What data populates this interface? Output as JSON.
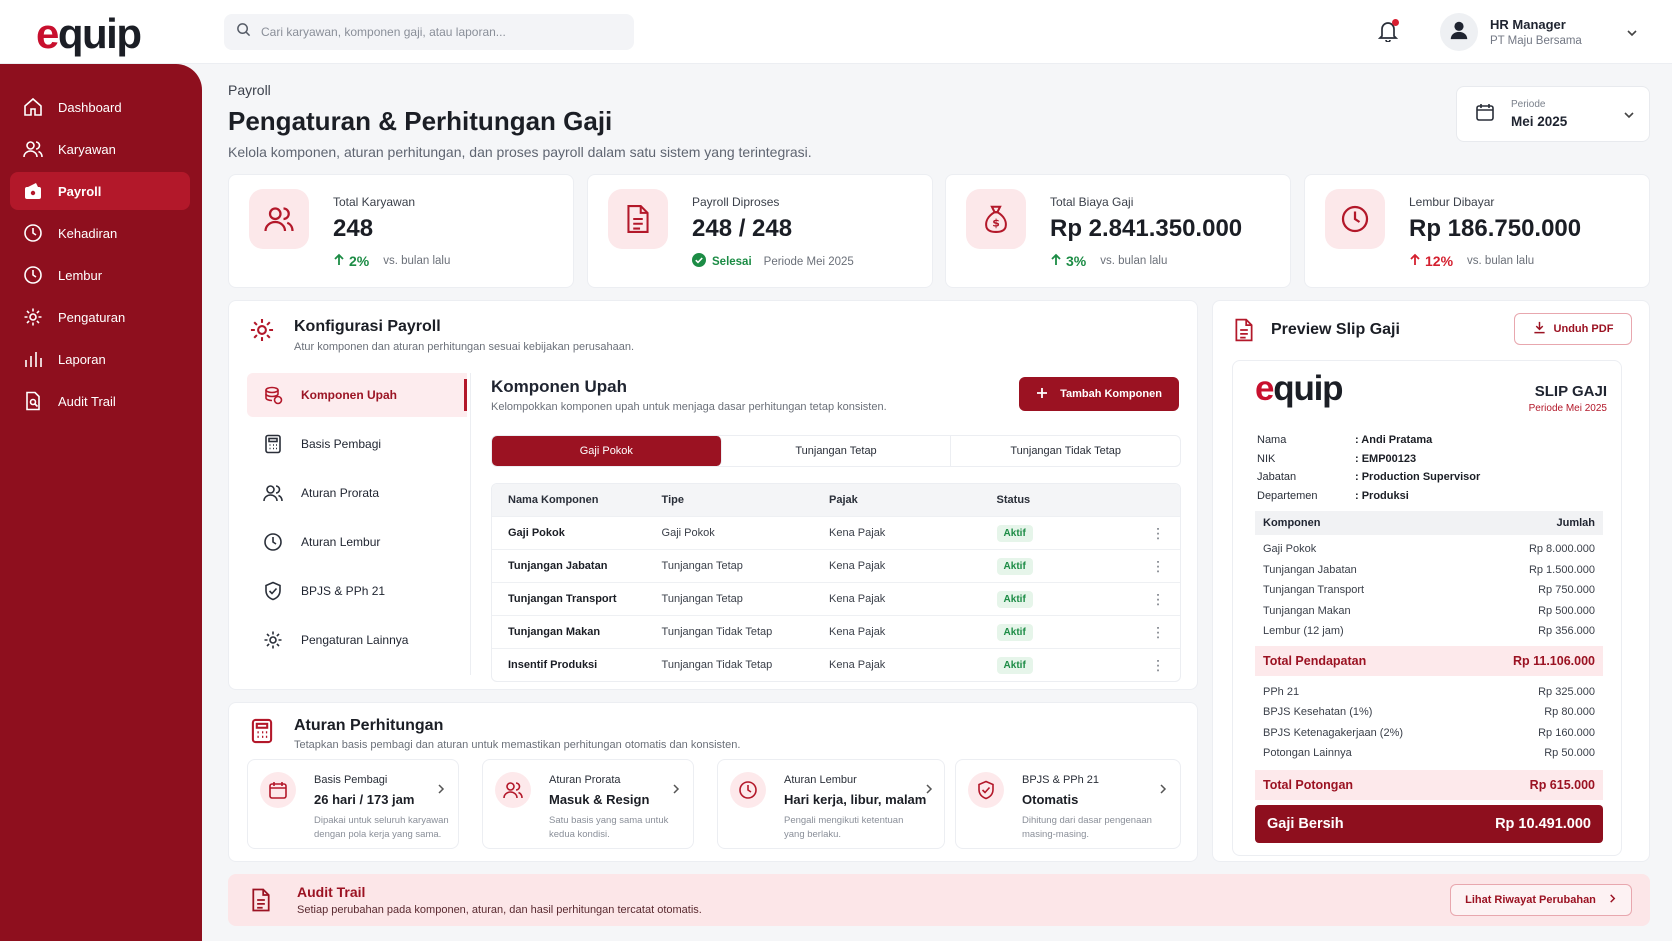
{
  "app": {
    "logo_e": "e",
    "logo_rest": "quip",
    "search_placeholder": "Cari karyawan, komponen gaji, atau laporan...",
    "user_name": "HR Manager",
    "user_company": "PT Maju Bersama"
  },
  "sidebar": {
    "items": [
      {
        "label": "Dashboard",
        "icon": "home-icon"
      },
      {
        "label": "Karyawan",
        "icon": "users-icon"
      },
      {
        "label": "Payroll",
        "icon": "wallet-icon",
        "active": true
      },
      {
        "label": "Kehadiran",
        "icon": "clock-icon"
      },
      {
        "label": "Lembur",
        "icon": "clock-icon"
      },
      {
        "label": "Pengaturan",
        "icon": "gear-icon"
      },
      {
        "label": "Laporan",
        "icon": "bar-chart-icon"
      },
      {
        "label": "Audit Trail",
        "icon": "document-search-icon"
      }
    ]
  },
  "page": {
    "breadcrumb": "Payroll",
    "title": "Pengaturan & Perhitungan Gaji",
    "subtitle": "Kelola komponen, aturan perhitungan, dan proses payroll dalam satu sistem yang terintegrasi.",
    "periode_label": "Periode",
    "periode_value": "Mei 2025"
  },
  "stats": [
    {
      "label": "Total Karyawan",
      "value": "248",
      "delta": "2%",
      "note": "vs. bulan lalu"
    },
    {
      "label": "Payroll Diproses",
      "value": "248 / 248",
      "status": "Selesai",
      "note": "Periode Mei 2025"
    },
    {
      "label": "Total Biaya Gaji",
      "value": "Rp 2.841.350.000",
      "delta": "3%",
      "note": "vs. bulan lalu"
    },
    {
      "label": "Lembur Dibayar",
      "value": "Rp 186.750.000",
      "delta": "12%",
      "note": "vs. bulan lalu"
    }
  ],
  "config": {
    "title": "Konfigurasi Payroll",
    "subtitle": "Atur komponen dan aturan perhitungan sesuai kebijakan perusahaan.",
    "menu": [
      "Komponen Upah",
      "Basis Pembagi",
      "Aturan Prorata",
      "Aturan Lembur",
      "BPJS & PPh 21",
      "Pengaturan Lainnya"
    ],
    "komponen_title": "Komponen Upah",
    "komponen_sub": "Kelompokkan komponen upah untuk menjaga dasar perhitungan tetap konsisten.",
    "add_button": "Tambah Komponen",
    "tabs": [
      "Gaji Pokok",
      "Tunjangan Tetap",
      "Tunjangan Tidak Tetap"
    ],
    "table_headers": [
      "Nama Komponen",
      "Tipe",
      "Pajak",
      "Status"
    ],
    "rows": [
      [
        "Gaji Pokok",
        "Gaji Pokok",
        "Kena Pajak",
        "Aktif"
      ],
      [
        "Tunjangan Jabatan",
        "Tunjangan Tetap",
        "Kena Pajak",
        "Aktif"
      ],
      [
        "Tunjangan Transport",
        "Tunjangan Tetap",
        "Kena Pajak",
        "Aktif"
      ],
      [
        "Tunjangan Makan",
        "Tunjangan Tidak Tetap",
        "Kena Pajak",
        "Aktif"
      ],
      [
        "Insentif Produksi",
        "Tunjangan Tidak Tetap",
        "Kena Pajak",
        "Aktif"
      ]
    ]
  },
  "rules": {
    "title": "Aturan Perhitungan",
    "subtitle": "Tetapkan basis pembagi dan aturan untuk memastikan perhitungan otomatis dan konsisten.",
    "cards": [
      {
        "label": "Basis Pembagi",
        "value": "26 hari / 173 jam",
        "desc": "Dipakai untuk seluruh karyawan dengan pola kerja yang sama."
      },
      {
        "label": "Aturan Prorata",
        "value": "Masuk & Resign",
        "desc": "Satu basis yang sama untuk kedua kondisi."
      },
      {
        "label": "Aturan Lembur",
        "value": "Hari kerja, libur, malam",
        "desc": "Pengali mengikuti ketentuan yang berlaku."
      },
      {
        "label": "BPJS & PPh 21",
        "value": "Otomatis",
        "desc": "Dihitung dari dasar pengenaan masing-masing."
      }
    ]
  },
  "slip": {
    "panel_title": "Preview Slip Gaji",
    "download": "Unduh PDF",
    "title": "SLIP GAJI",
    "periode": "Periode Mei 2025",
    "info": [
      {
        "k": "Nama",
        "v": ": Andi Pratama"
      },
      {
        "k": "NIK",
        "v": ": EMP00123"
      },
      {
        "k": "Jabatan",
        "v": ": Production Supervisor"
      },
      {
        "k": "Departemen",
        "v": ": Produksi"
      }
    ],
    "head_komponen": "Komponen",
    "head_jumlah": "Jumlah",
    "earnings": [
      {
        "k": "Gaji Pokok",
        "v": "Rp 8.000.000"
      },
      {
        "k": "Tunjangan Jabatan",
        "v": "Rp 1.500.000"
      },
      {
        "k": "Tunjangan Transport",
        "v": "Rp 750.000"
      },
      {
        "k": "Tunjangan Makan",
        "v": "Rp 500.000"
      },
      {
        "k": "Lembur (12 jam)",
        "v": "Rp 356.000"
      }
    ],
    "total_income_label": "Total Pendapatan",
    "total_income": "Rp 11.106.000",
    "deductions": [
      {
        "k": "PPh 21",
        "v": "Rp 325.000"
      },
      {
        "k": "BPJS Kesehatan (1%)",
        "v": "Rp 80.000"
      },
      {
        "k": "BPJS Ketenagakerjaan (2%)",
        "v": "Rp 160.000"
      },
      {
        "k": "Potongan Lainnya",
        "v": "Rp 50.000"
      }
    ],
    "total_deduction_label": "Total Potongan",
    "total_deduction": "Rp 615.000",
    "net_label": "Gaji Bersih",
    "net": "Rp 10.491.000"
  },
  "audit": {
    "title": "Audit Trail",
    "subtitle": "Setiap perubahan pada komponen, aturan, dan hasil perhitungan tercatat otomatis.",
    "button": "Lihat Riwayat Perubahan"
  },
  "colors": {
    "brand": "#8e0f1e",
    "accent": "#c8102e",
    "success": "#1c8c45"
  }
}
